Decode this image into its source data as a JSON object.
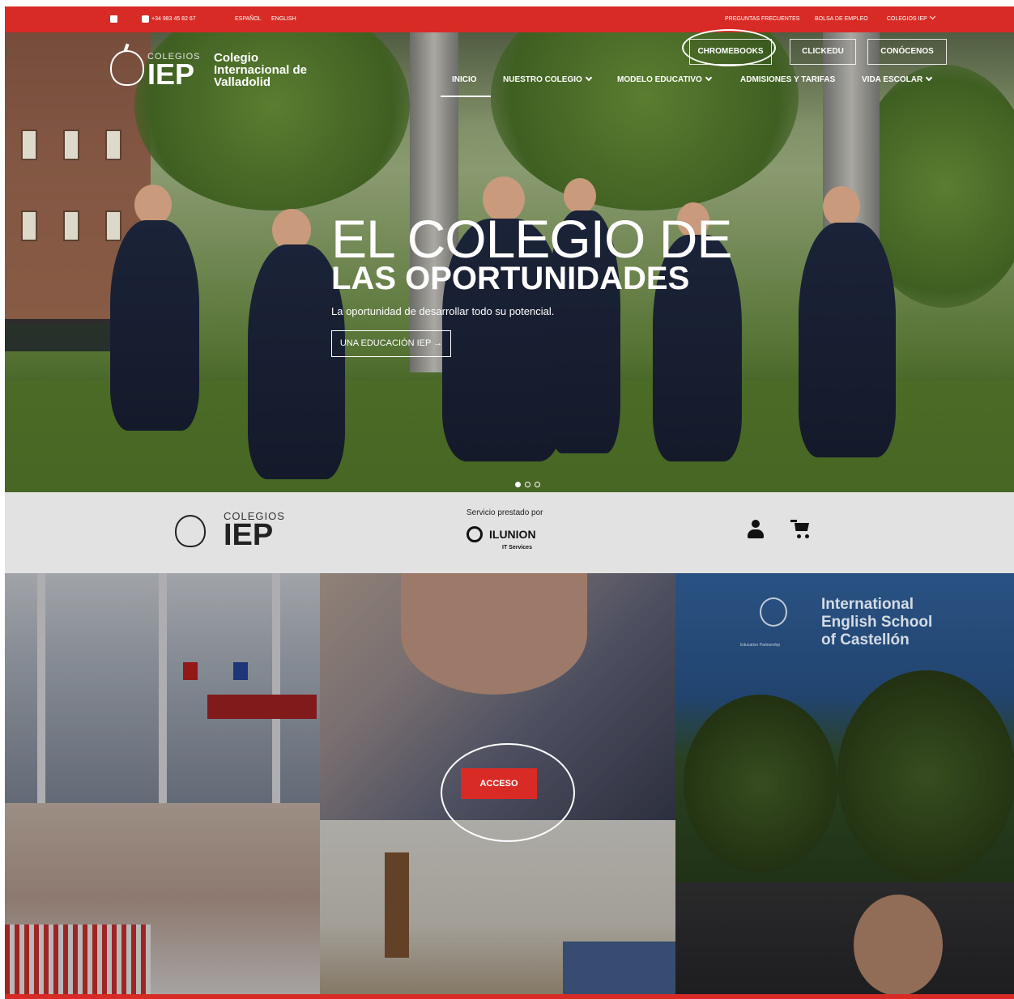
{
  "topbar": {
    "phone": "+34 983 45 82 67",
    "languages": [
      "ESPAÑOL",
      "ENGLISH"
    ],
    "links": [
      "PREGUNTAS FRECUENTES",
      "BOLSA DE EMPLEO",
      "COLEGIOS IEP"
    ]
  },
  "logo": {
    "colegios": "COLEGIOS",
    "iep": "IEP",
    "name": "Colegio Internacional de Valladolid"
  },
  "buttons": [
    "CHROMEBOOKS",
    "CLICKEDU",
    "CONÓCENOS"
  ],
  "nav": [
    "INICIO",
    "NUESTRO COLEGIO",
    "MODELO EDUCATIVO",
    "ADMISIONES Y TARIFAS",
    "VIDA ESCOLAR"
  ],
  "hero": {
    "title_line1": "EL COLEGIO DE",
    "title_line2": "LAS OPORTUNIDADES",
    "subtitle": "La oportunidad de desarrollar todo su potencial.",
    "cta": "UNA EDUCACIÓN IEP →"
  },
  "band": {
    "colegios": "COLEGIOS",
    "iep": "IEP",
    "service_label": "Servicio prestado por",
    "ilunion": "ILUNION",
    "it_services": "IT Services"
  },
  "grid": {
    "sign": "International English School of Castellón",
    "sign_tagline": "Education Partnership",
    "acceso": "ACCESO"
  },
  "icons": [
    "facebook-icon",
    "phone-icon",
    "user-icon",
    "cart-icon",
    "chevron-down-icon"
  ],
  "colors": {
    "brand_red": "#d92b26",
    "band_gray": "#e2e2e2"
  },
  "slider": {
    "slides": 3,
    "active": 1
  }
}
